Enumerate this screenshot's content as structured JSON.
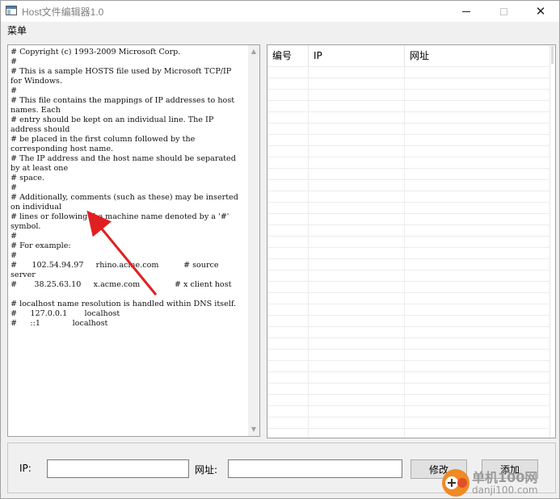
{
  "window": {
    "title": "Host文件编辑器1.0",
    "controls": {
      "minimize": "—",
      "maximize": "",
      "close": "✕"
    }
  },
  "menu": {
    "label": "菜单"
  },
  "hosts_text": "# Copyright (c) 1993-2009 Microsoft Corp.\n#\n# This is a sample HOSTS file used by Microsoft TCP/IP for Windows.\n#\n# This file contains the mappings of IP addresses to host names. Each\n# entry should be kept on an individual line. The IP address should\n# be placed in the first column followed by the corresponding host name.\n# The IP address and the host name should be separated by at least one\n# space.\n#\n# Additionally, comments (such as these) may be inserted on individual\n# lines or following the machine name denoted by a '#' symbol.\n#\n# For example:\n#\n#      102.54.94.97     rhino.acme.com          # source server\n#       38.25.63.10     x.acme.com              # x client host\n\n# localhost name resolution is handled within DNS itself.\n#\t127.0.0.1       localhost\n#\t::1             localhost",
  "table": {
    "columns": [
      "编号",
      "IP",
      "网址"
    ],
    "rows": []
  },
  "form": {
    "ip_label": "IP:",
    "ip_value": "",
    "url_label": "网址:",
    "url_value": "",
    "edit_button": "修改",
    "add_button": "添加"
  },
  "annotation": {
    "color": "#e02020"
  },
  "watermark": {
    "name": "单机100网",
    "site": "danji100.com"
  }
}
